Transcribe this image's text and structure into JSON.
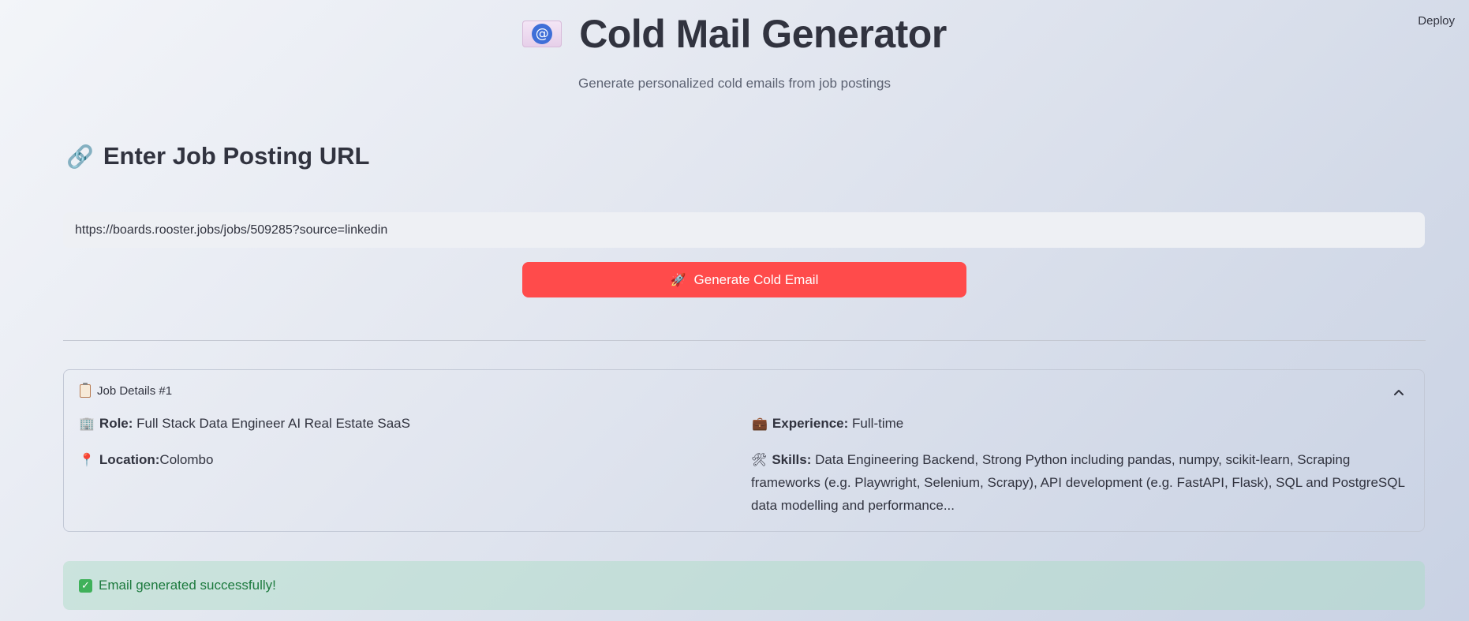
{
  "header": {
    "deploy_label": "Deploy",
    "title": "Cold Mail Generator",
    "subtitle": "Generate personalized cold emails from job postings",
    "icon": "envelope-at-icon"
  },
  "input_section": {
    "heading": "Enter Job Posting URL",
    "icon": "link-icon",
    "url_value": "https://boards.rooster.jobs/jobs/509285?source=linkedin",
    "button_label": "Generate Cold Email",
    "button_icon": "rocket-icon",
    "button_color": "#ff4b4b"
  },
  "job_details": {
    "header": "Job Details #1",
    "expanded": true,
    "role_label": "Role:",
    "role_value": "Full Stack Data Engineer AI Real Estate SaaS",
    "location_label": "Location:",
    "location_value": "Colombo",
    "experience_label": "Experience:",
    "experience_value": "Full-time",
    "skills_label": "Skills:",
    "skills_value": "Data Engineering Backend, Strong Python including pandas, numpy, scikit-learn, Scraping frameworks (e.g. Playwright, Selenium, Scrapy), API development (e.g. FastAPI, Flask), SQL and PostgreSQL data modelling and performance..."
  },
  "status": {
    "message": "Email generated successfully!",
    "color": "#1d7a3e"
  }
}
